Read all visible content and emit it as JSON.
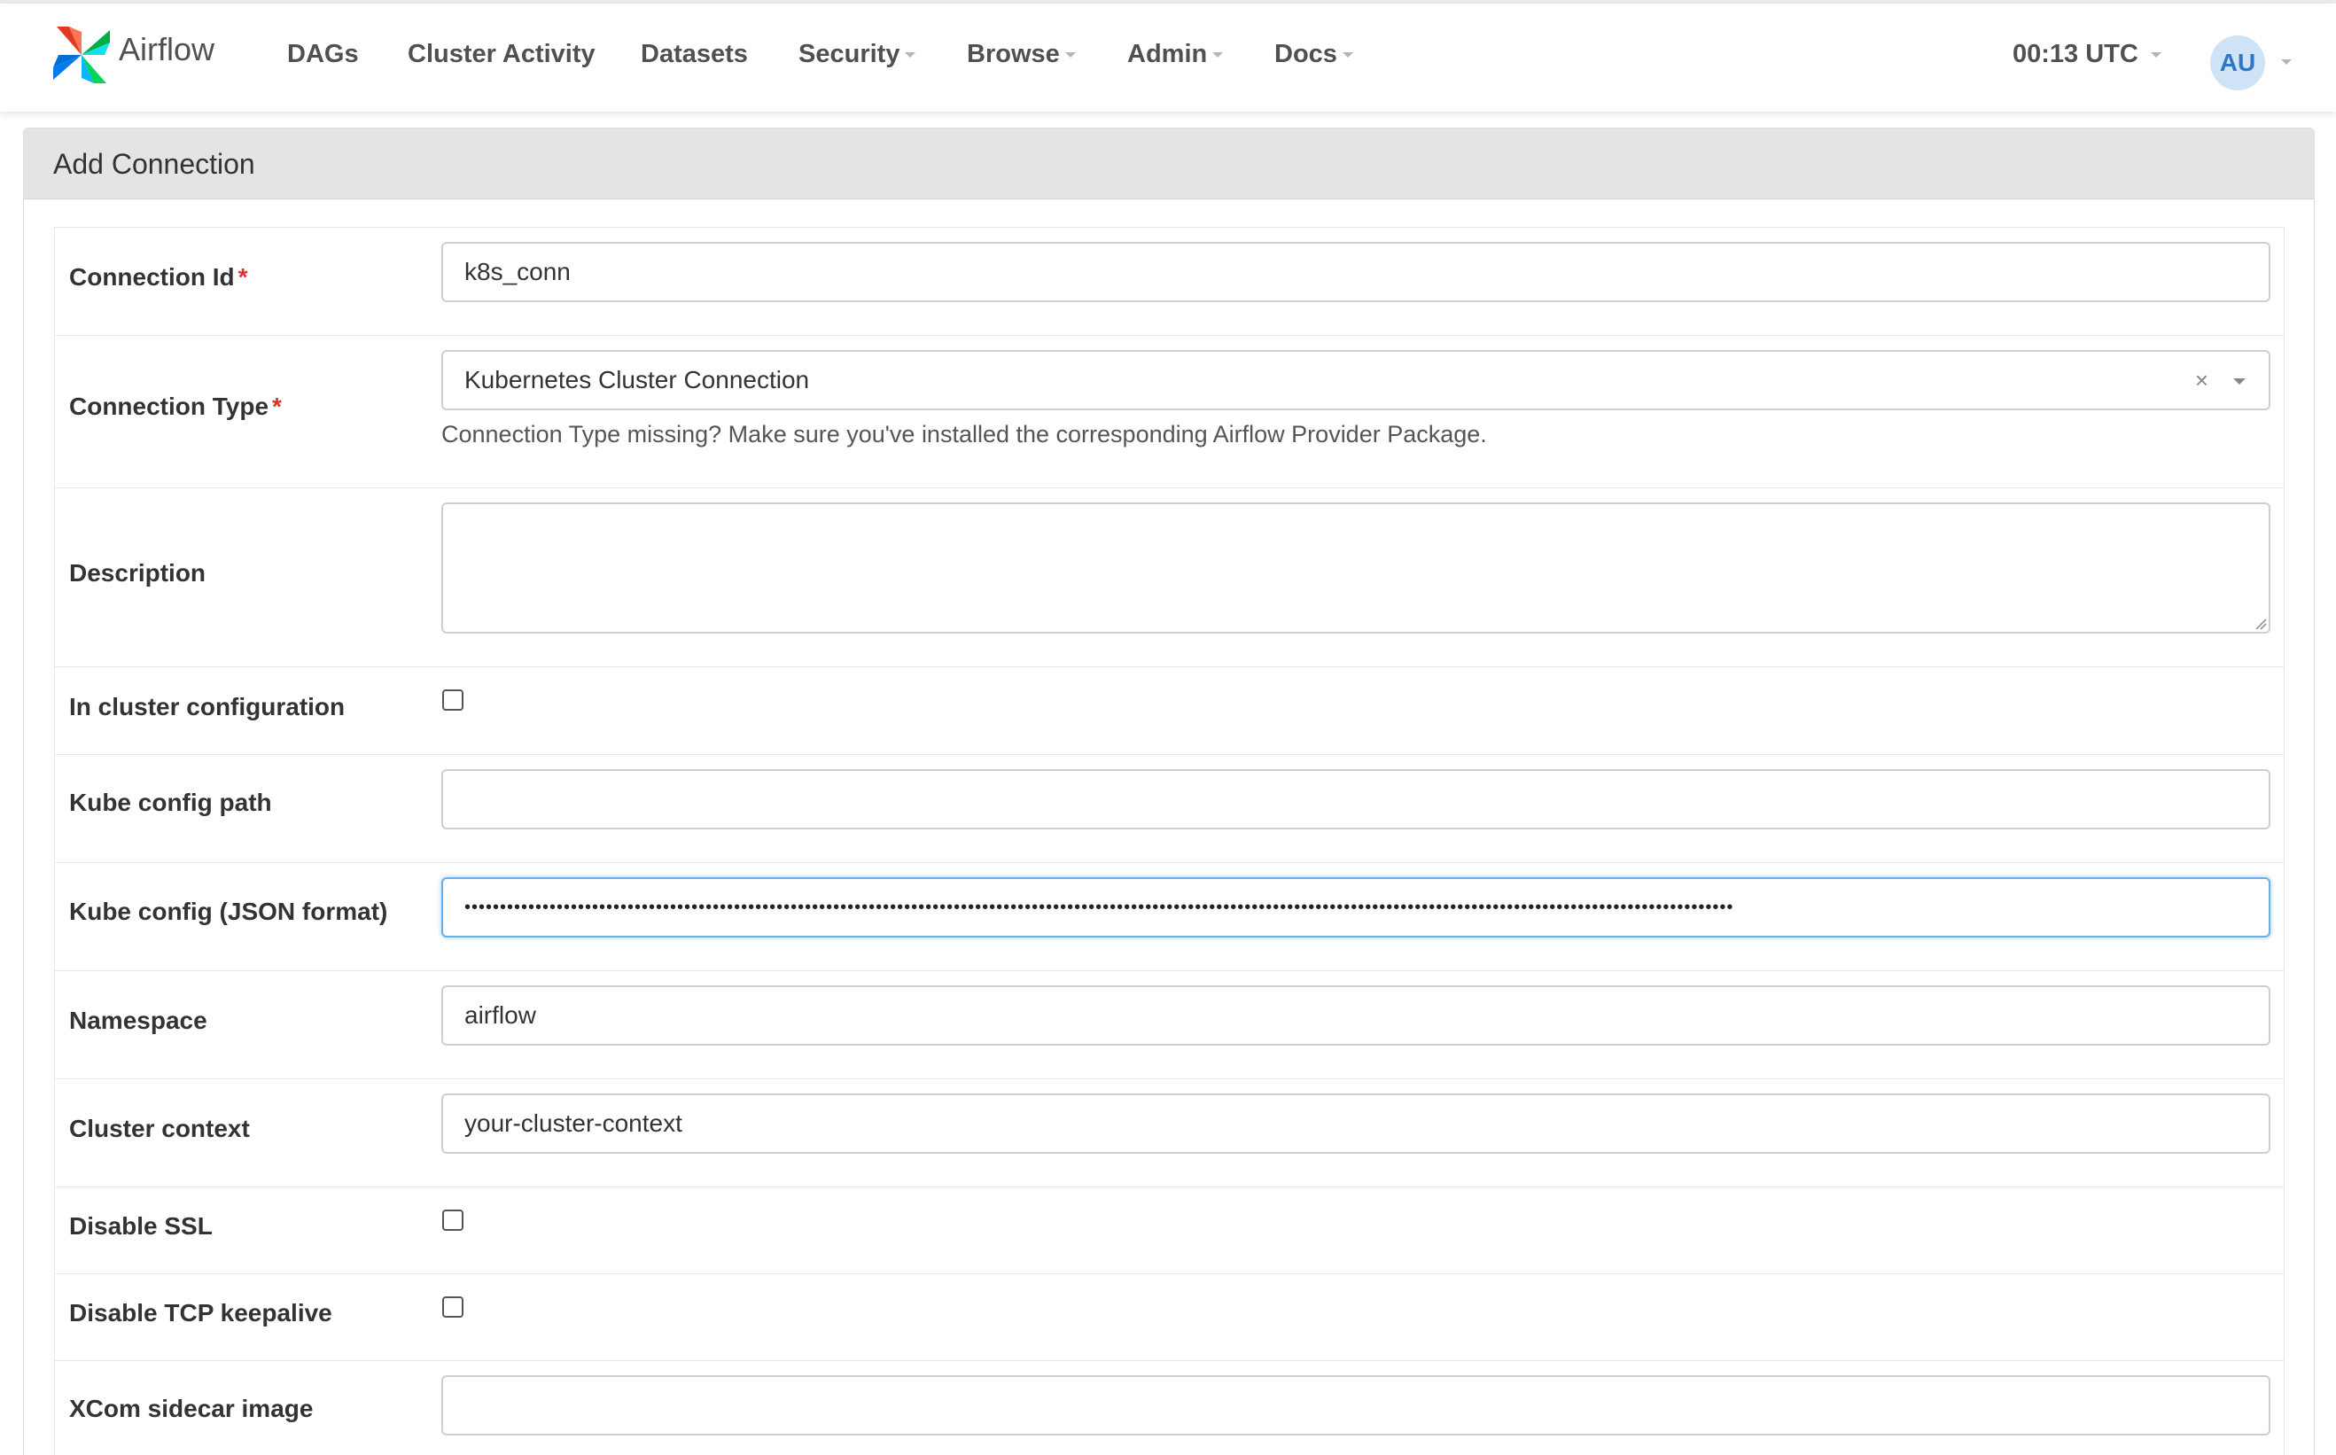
{
  "app": {
    "brand_name": "Airflow",
    "nav": {
      "dags": "DAGs",
      "cluster_activity": "Cluster Activity",
      "datasets": "Datasets",
      "security": "Security",
      "browse": "Browse",
      "admin": "Admin",
      "docs": "Docs"
    },
    "clock": "00:13 UTC",
    "user_initials": "AU"
  },
  "form": {
    "title": "Add Connection",
    "required_marker": "*",
    "connection_id": {
      "label": "Connection Id",
      "value": "k8s_conn"
    },
    "connection_type": {
      "label": "Connection Type",
      "value": "Kubernetes Cluster Connection",
      "clear_glyph": "×",
      "help": "Connection Type missing? Make sure you've installed the corresponding Airflow Provider Package."
    },
    "description": {
      "label": "Description",
      "value": ""
    },
    "in_cluster": {
      "label": "In cluster configuration",
      "checked": false
    },
    "kube_config_path": {
      "label": "Kube config path",
      "value": ""
    },
    "kube_config_json": {
      "label": "Kube config (JSON format)",
      "masked_value": "•••••••••••••••••••••••••••••••••••••••••••••••••••••••••••••••••••••••••••••••••••••••••••••••••••••••••••••••••••••••••••••••••••••••••••••••••••••••••••••••••••••••••••••••••••"
    },
    "namespace": {
      "label": "Namespace",
      "value": "airflow"
    },
    "cluster_context": {
      "label": "Cluster context",
      "value": "your-cluster-context"
    },
    "disable_ssl": {
      "label": "Disable SSL",
      "checked": false
    },
    "disable_tcp_keepalive": {
      "label": "Disable TCP keepalive",
      "checked": false
    },
    "xcom_sidecar_image": {
      "label": "XCom sidecar image",
      "value": ""
    }
  },
  "colors": {
    "accent_focus": "#66afe9",
    "required": "#d9342b",
    "avatar_bg": "#cfe3f6",
    "avatar_text": "#2e77c4",
    "panel_heading_bg": "#e4e4e4"
  },
  "icons": {
    "logo": "airflow-pinwheel-logo",
    "dropdown": "caret-down-icon",
    "clear": "close-icon",
    "resize": "resize-grip-icon"
  }
}
